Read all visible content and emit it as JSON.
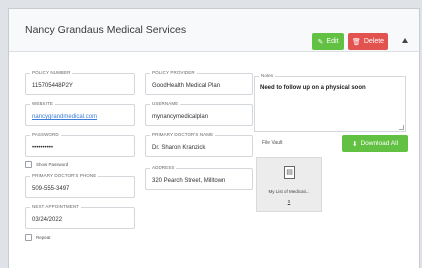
{
  "header": {
    "title": "Nancy Grandaus Medical Services",
    "edit_label": "Edit",
    "delete_label": "Delete"
  },
  "fields": {
    "policy_number": {
      "label": "POLICY NUMBER",
      "value": "115705448P2Y"
    },
    "policy_provider": {
      "label": "POLICY PROVIDER",
      "value": "GoodHealth Medical Plan"
    },
    "website": {
      "label": "WEBSITE",
      "value": "nancygrandmedical.com"
    },
    "username": {
      "label": "USERNAME",
      "value": "mynancymedicalplan"
    },
    "password": {
      "label": "PASSWORD",
      "value": "••••••••••"
    },
    "primary_doctor_name": {
      "label": "PRIMARY DOCTOR'S NAME",
      "value": "Dr. Sharon Kranzick"
    },
    "primary_doctor_phone": {
      "label": "PRIMARY DOCTOR'S PHONE",
      "value": "509-555-3497"
    },
    "address": {
      "label": "ADDRESS",
      "value": "320 Pearch Street, Milltown"
    },
    "next_appointment": {
      "label": "NEXT APPOINTMENT",
      "value": "03/24/2022"
    }
  },
  "show_password_label": "Show Password",
  "repeat_label": "Repeat",
  "notes": {
    "label": "Notes",
    "value": "Need to follow up on a physical soon"
  },
  "vault": {
    "label": "File Vault",
    "download_label": "Download All",
    "file_name": "My List of Medicati...",
    "file_extra": "0"
  }
}
